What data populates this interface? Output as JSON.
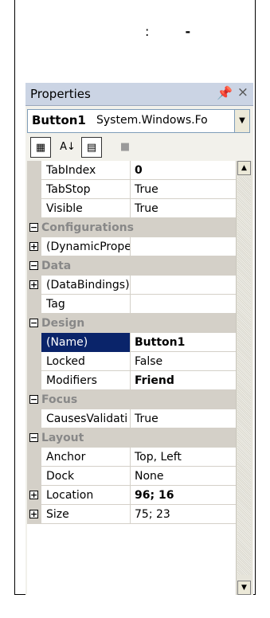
{
  "header": {
    "colon": ":",
    "dash": "-"
  },
  "panel": {
    "title": "Properties",
    "pin_glyph": "P",
    "close_glyph": "×"
  },
  "selector": {
    "object_name": "Button1",
    "object_type": "System.Windows.Fo"
  },
  "toolbar": {
    "categorized": "categorized",
    "alphabetical": "alphabetical",
    "properties": "properties",
    "events": "events"
  },
  "rows": [
    {
      "kind": "prop",
      "name": "TabIndex",
      "value": "0",
      "bold": true
    },
    {
      "kind": "prop",
      "name": "TabStop",
      "value": "True"
    },
    {
      "kind": "prop",
      "name": "Visible",
      "value": "True"
    },
    {
      "kind": "cat",
      "name": "Configurations"
    },
    {
      "kind": "prop",
      "name": "(DynamicPrope",
      "value": "",
      "expand": "+"
    },
    {
      "kind": "cat",
      "name": "Data"
    },
    {
      "kind": "prop",
      "name": "(DataBindings)",
      "value": "",
      "expand": "+"
    },
    {
      "kind": "prop",
      "name": "Tag",
      "value": ""
    },
    {
      "kind": "cat",
      "name": "Design"
    },
    {
      "kind": "prop",
      "name": "(Name)",
      "value": "Button1",
      "bold": true,
      "selected": true
    },
    {
      "kind": "prop",
      "name": "Locked",
      "value": "False"
    },
    {
      "kind": "prop",
      "name": "Modifiers",
      "value": "Friend",
      "bold": true
    },
    {
      "kind": "cat",
      "name": "Focus"
    },
    {
      "kind": "prop",
      "name": "CausesValidati",
      "value": "True"
    },
    {
      "kind": "cat",
      "name": "Layout"
    },
    {
      "kind": "prop",
      "name": "Anchor",
      "value": "Top, Left"
    },
    {
      "kind": "prop",
      "name": "Dock",
      "value": "None"
    },
    {
      "kind": "prop",
      "name": "Location",
      "value": "96; 16",
      "bold": true,
      "expand": "+"
    },
    {
      "kind": "prop",
      "name": "Size",
      "value": "75; 23",
      "expand": "+"
    }
  ]
}
